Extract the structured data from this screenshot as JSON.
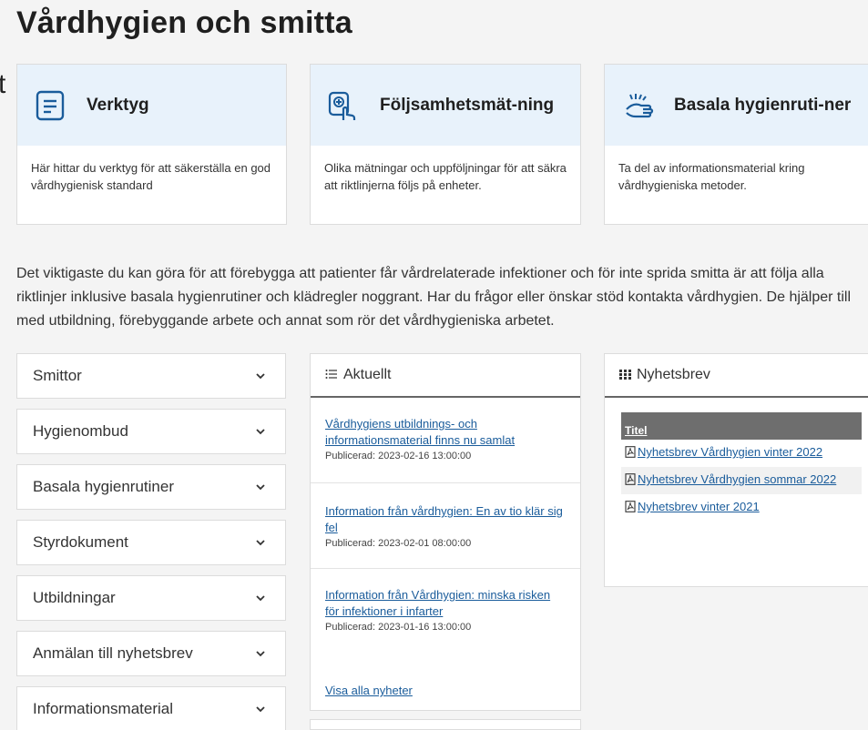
{
  "page_title": "Vårdhygien och smitta",
  "stray_char": "t",
  "cards": [
    {
      "title": "Verktyg",
      "icon": "document-list-icon",
      "body": "Här hittar du verktyg för att säkerställa en god vårdhygienisk standard"
    },
    {
      "title": "Följsamhetsmät-ning",
      "icon": "hand-checklist-icon",
      "body": "Olika mätningar och uppföljningar för att säkra att riktlinjerna följs på enheter."
    },
    {
      "title": "Basala hygienruti-ner",
      "icon": "handwash-icon",
      "body": "Ta del av informationsmaterial kring vårdhygieniska metoder."
    }
  ],
  "intro": "Det viktigaste du kan göra för att förebygga att patienter får vårdrelaterade infektioner och för inte sprida smitta är att följa alla riktlinjer inklusive basala hygienrutiner och klädregler noggrant. Har du frågor eller önskar stöd kontakta vårdhygien. De hjälper till med utbildning, förebyggande arbete och annat som rör det vårdhygieniska arbetet.",
  "accordion": [
    "Smittor",
    "Hygienombud",
    "Basala hygienrutiner",
    "Styrdokument",
    "Utbildningar",
    "Anmälan till nyhetsbrev",
    "Informationsmaterial"
  ],
  "news": {
    "heading": "Aktuellt",
    "icon": "list-icon",
    "items": [
      {
        "title": "Vårdhygiens utbildnings- och informationsmaterial finns nu samlat",
        "date": "Publicerad: 2023-02-16 13:00:00"
      },
      {
        "title": "Information från vårdhygien: En av tio klär sig fel",
        "date": "Publicerad: 2023-02-01 08:00:00"
      },
      {
        "title": "Information från Vårdhygien: minska risken för infektioner i infarter",
        "date": "Publicerad: 2023-01-16 13:00:00"
      }
    ],
    "all_link": "Visa alla nyheter"
  },
  "newsletter": {
    "heading": "Nyhetsbrev",
    "icon": "grid-icon",
    "column": "Titel",
    "items": [
      "Nyhetsbrev Vårdhygien vinter 2022",
      "Nyhetsbrev Vårdhygien sommar 2022",
      "Nyhetsbrev vinter 2021"
    ]
  }
}
